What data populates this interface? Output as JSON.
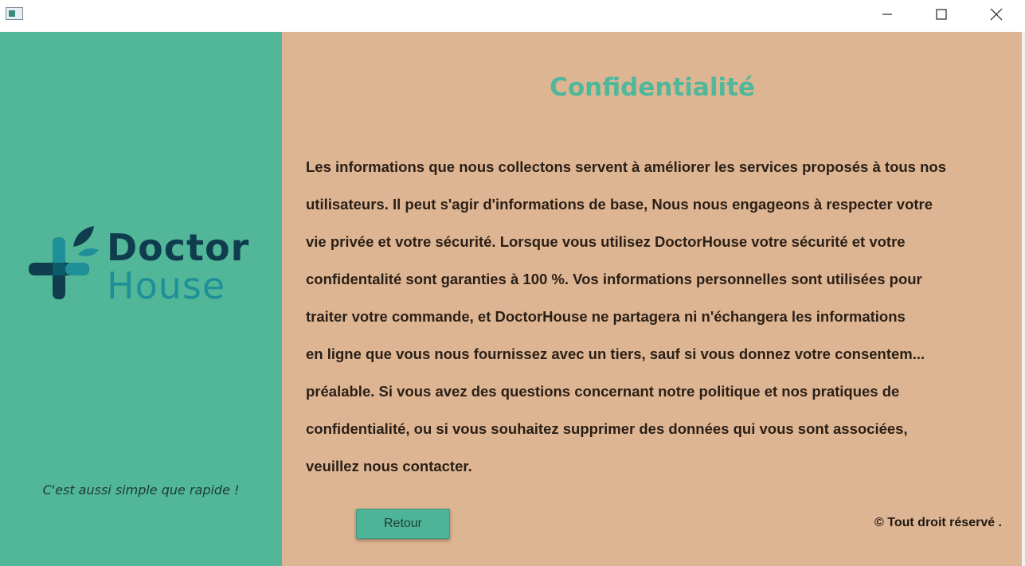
{
  "window": {
    "controls": {
      "minimize_icon": "minimize-icon",
      "maximize_icon": "maximize-icon",
      "close_icon": "close-icon"
    }
  },
  "sidebar": {
    "logo": {
      "line1": "Doctor",
      "line2": "House",
      "colors": {
        "dark": "#103d4e",
        "teal": "#1f8f98",
        "leaf": "#103d4e"
      }
    },
    "tagline": "C'est aussi simple que rapide !",
    "background": "#52b799"
  },
  "main": {
    "background": "#deb592",
    "title": "Confidentialité",
    "title_color": "#4fb79a",
    "paragraph_lines": [
      "Les informations que nous collectons servent à améliorer les services proposés à tous nos",
      "utilisateurs. Il peut s'agir d'informations de base, Nous nous engageons à respecter votre",
      "vie privée et votre sécurité. Lorsque vous utilisez DoctorHouse votre sécurité et votre",
      "confidentalité sont garanties à 100 %. Vos informations personnelles sont utilisées pour",
      "traiter votre commande, et DoctorHouse ne partagera ni n'échangera les informations",
      "en ligne que vous nous fournissez avec un tiers, sauf si vous donnez votre consentem...",
      "préalable. Si vous avez des questions concernant notre politique et nos pratiques de",
      "confidentialité, ou si vous souhaitez supprimer des données qui vous sont associées,",
      "veuillez nous contacter."
    ],
    "back_button_label": "Retour",
    "copyright": "© Tout droit réservé ."
  }
}
